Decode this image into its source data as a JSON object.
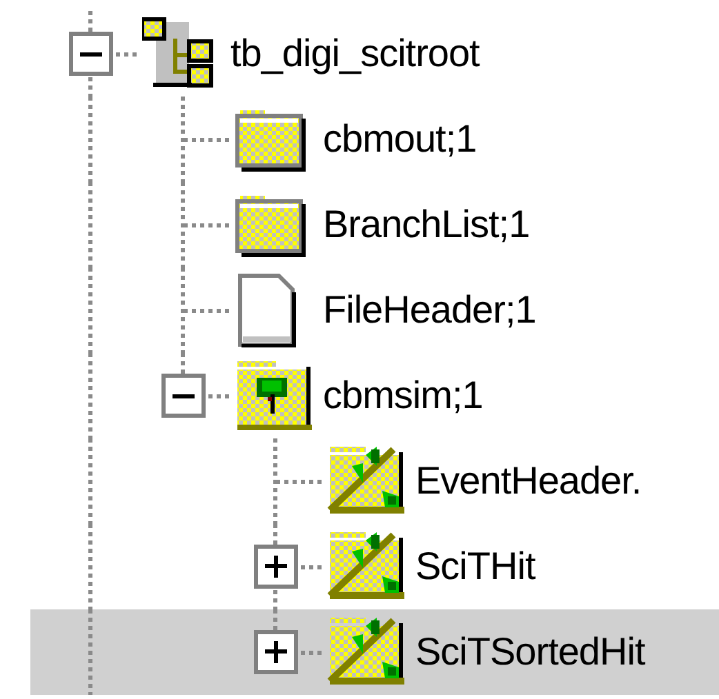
{
  "tree": [
    {
      "label": "tb_digi_scitroot",
      "kind": "root",
      "expanded": true,
      "selected": false,
      "children": [
        {
          "label": "cbmout;1",
          "kind": "folder",
          "selected": false
        },
        {
          "label": "BranchList;1",
          "kind": "folder",
          "selected": false
        },
        {
          "label": "FileHeader;1",
          "kind": "file",
          "selected": false
        },
        {
          "label": "cbmsim;1",
          "kind": "tree",
          "expanded": true,
          "selected": false,
          "children": [
            {
              "label": "EventHeader.",
              "kind": "branch",
              "selected": false
            },
            {
              "label": "SciTHit",
              "kind": "branch",
              "expanded": false,
              "selected": false
            },
            {
              "label": "SciTSortedHit",
              "kind": "branch",
              "expanded": false,
              "selected": true
            }
          ]
        }
      ]
    }
  ]
}
